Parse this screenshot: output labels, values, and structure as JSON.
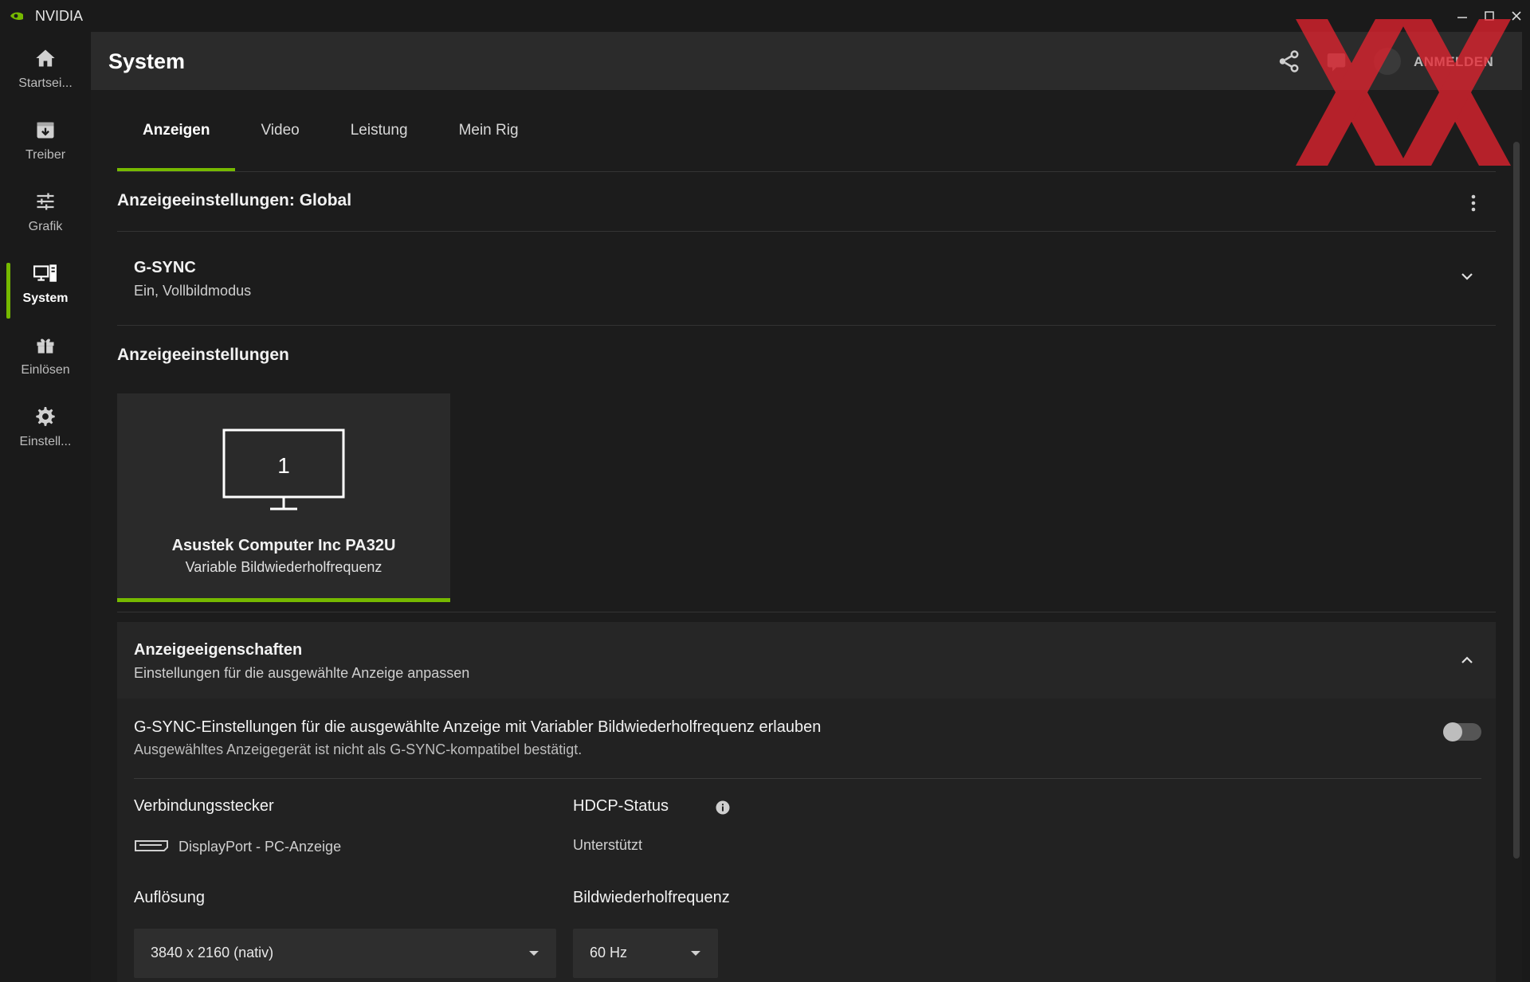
{
  "window": {
    "title": "NVIDIA"
  },
  "sidebar": {
    "items": [
      {
        "label": "Startsei...",
        "icon": "home-icon"
      },
      {
        "label": "Treiber",
        "icon": "download-box-icon"
      },
      {
        "label": "Grafik",
        "icon": "sliders-icon"
      },
      {
        "label": "System",
        "icon": "system-monitor-icon",
        "active": true
      },
      {
        "label": "Einlösen",
        "icon": "gift-icon"
      },
      {
        "label": "Einstell...",
        "icon": "gear-icon"
      }
    ]
  },
  "header": {
    "title": "System",
    "login_label": "ANMELDEN"
  },
  "tabs": [
    {
      "label": "Anzeigen",
      "active": true
    },
    {
      "label": "Video"
    },
    {
      "label": "Leistung"
    },
    {
      "label": "Mein Rig"
    }
  ],
  "global": {
    "title": "Anzeigeeinstellungen: Global"
  },
  "gsync": {
    "title": "G-SYNC",
    "value": "Ein, Vollbildmodus"
  },
  "display_settings": {
    "title": "Anzeigeeinstellungen",
    "monitor": {
      "number": "1",
      "name": "Asustek Computer Inc PA32U",
      "subtitle": "Variable Bildwiederholfrequenz"
    }
  },
  "properties": {
    "title": "Anzeigeeigenschaften",
    "subtitle": "Einstellungen für die ausgewählte Anzeige anpassen",
    "allow_gsync": {
      "title": "G-SYNC-Einstellungen für die ausgewählte Anzeige mit Variabler Bildwiederholfrequenz erlauben",
      "subtitle": "Ausgewähltes Anzeigegerät ist nicht als G-SYNC-kompatibel bestätigt.",
      "enabled": false
    },
    "connector": {
      "label": "Verbindungsstecker",
      "value": "DisplayPort - PC-Anzeige"
    },
    "hdcp": {
      "label": "HDCP-Status",
      "value": "Unterstützt"
    },
    "resolution": {
      "label": "Auflösung",
      "value": "3840 x 2160 (nativ)"
    },
    "refresh": {
      "label": "Bildwiederholfrequenz",
      "value": "60 Hz"
    }
  },
  "colors": {
    "accent": "#76b900",
    "header_bg": "#2b2b2b",
    "card_bg": "#2a2a2a"
  }
}
